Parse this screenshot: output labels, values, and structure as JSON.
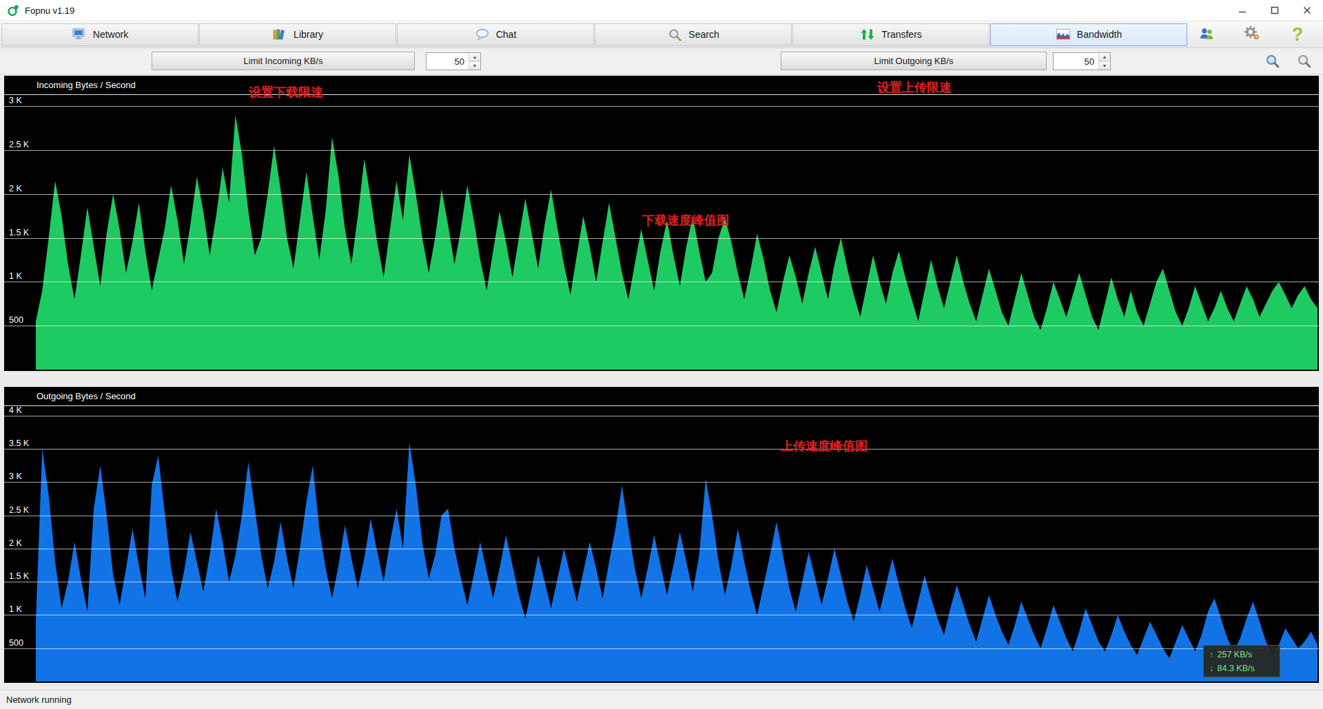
{
  "window": {
    "title": "Fopnu v1.19"
  },
  "nav_tabs": [
    {
      "label": "Network",
      "icon": "network-icon"
    },
    {
      "label": "Library",
      "icon": "library-icon"
    },
    {
      "label": "Chat",
      "icon": "chat-icon"
    },
    {
      "label": "Search",
      "icon": "search-icon"
    },
    {
      "label": "Transfers",
      "icon": "transfers-icon"
    },
    {
      "label": "Bandwidth",
      "icon": "bandwidth-icon",
      "active": true
    }
  ],
  "toolbar": {
    "limit_incoming": "Limit Incoming KB/s",
    "incoming_value": "50",
    "limit_outgoing": "Limit Outgoing KB/s",
    "outgoing_value": "50"
  },
  "icons": {
    "spin_up": "▲",
    "spin_down": "▼",
    "up_arrow": "↑",
    "down_arrow": "↓"
  },
  "annotations": {
    "set_download_limit": "设置下载限速",
    "set_upload_limit": "设置上传限速",
    "download_peak": "下载速度峰值图",
    "upload_peak": "上传速度峰值图"
  },
  "rate_overlay": {
    "up": "257 KB/s",
    "down": "84.3 KB/s"
  },
  "status": "Network running",
  "colors": {
    "incoming_fill": "#1ecb62",
    "outgoing_fill": "#1273e6",
    "chart_bg": "#000000",
    "grid": "#ffffff",
    "annotation_red": "#e02020",
    "active_tab": "#d9e8f8"
  },
  "chart_data": [
    {
      "type": "area",
      "title": "Incoming Bytes / Second",
      "color": "#1ecb62",
      "ymax": 3080,
      "yticks": [
        {
          "v": 3000,
          "label": "3 K"
        },
        {
          "v": 2500,
          "label": "2.5 K"
        },
        {
          "v": 2000,
          "label": "2 K"
        },
        {
          "v": 1500,
          "label": "1.5 K"
        },
        {
          "v": 1000,
          "label": "1 K"
        },
        {
          "v": 500,
          "label": "500"
        }
      ],
      "values": [
        550,
        900,
        1500,
        2150,
        1750,
        1200,
        800,
        1300,
        1850,
        1400,
        950,
        1550,
        2000,
        1600,
        1100,
        1450,
        1900,
        1350,
        900,
        1250,
        1600,
        2100,
        1700,
        1200,
        1650,
        2200,
        1800,
        1300,
        1750,
        2300,
        1900,
        2900,
        2450,
        1800,
        1300,
        1500,
        2000,
        2550,
        2050,
        1500,
        1150,
        1700,
        2250,
        1750,
        1250,
        1800,
        2650,
        2200,
        1600,
        1200,
        1750,
        2400,
        1950,
        1450,
        1050,
        1600,
        2150,
        1700,
        2450,
        2000,
        1500,
        1100,
        1500,
        2050,
        1650,
        1200,
        1600,
        2100,
        1700,
        1250,
        900,
        1350,
        1800,
        1450,
        1050,
        1500,
        1950,
        1550,
        1150,
        1650,
        2050,
        1600,
        1200,
        850,
        1300,
        1750,
        1400,
        1000,
        1450,
        1900,
        1500,
        1100,
        800,
        1200,
        1600,
        1250,
        900,
        1350,
        1700,
        1300,
        950,
        1400,
        1750,
        1350,
        1000,
        1100,
        1500,
        1730,
        1450,
        1100,
        800,
        1150,
        1550,
        1250,
        900,
        650,
        1000,
        1300,
        1050,
        750,
        1100,
        1400,
        1100,
        800,
        1200,
        1500,
        1150,
        850,
        600,
        950,
        1300,
        1000,
        750,
        1100,
        1350,
        1050,
        800,
        550,
        900,
        1250,
        950,
        700,
        1000,
        1300,
        1000,
        750,
        550,
        850,
        1150,
        900,
        650,
        500,
        800,
        1100,
        850,
        600,
        450,
        700,
        1000,
        800,
        600,
        850,
        1100,
        850,
        600,
        450,
        750,
        1050,
        800,
        600,
        900,
        650,
        500,
        750,
        1000,
        1150,
        900,
        650,
        500,
        700,
        950,
        750,
        550,
        700,
        900,
        700,
        550,
        750,
        950,
        800,
        600,
        750,
        900,
        1000,
        850,
        700,
        850,
        950,
        800,
        700
      ]
    },
    {
      "type": "area",
      "title": "Outgoing Bytes / Second",
      "color": "#1273e6",
      "ymax": 4080,
      "yticks": [
        {
          "v": 4000,
          "label": "4 K"
        },
        {
          "v": 3500,
          "label": "3.5 K"
        },
        {
          "v": 3000,
          "label": "3 K"
        },
        {
          "v": 2500,
          "label": "2.5 K"
        },
        {
          "v": 2000,
          "label": "2 K"
        },
        {
          "v": 1500,
          "label": "1.5 K"
        },
        {
          "v": 1000,
          "label": "1 K"
        },
        {
          "v": 500,
          "label": "500"
        }
      ],
      "values": [
        900,
        3500,
        2800,
        1800,
        1100,
        1500,
        2100,
        1550,
        1050,
        2600,
        3250,
        2500,
        1600,
        1150,
        1700,
        2300,
        1750,
        1250,
        2950,
        3400,
        2550,
        1700,
        1200,
        1650,
        2250,
        1800,
        1350,
        1900,
        2600,
        2100,
        1500,
        1900,
        2500,
        3300,
        2600,
        1900,
        1400,
        1800,
        2400,
        1850,
        1400,
        2000,
        2700,
        3250,
        2300,
        1700,
        1250,
        1750,
        2350,
        1850,
        1400,
        1850,
        2450,
        1950,
        1500,
        2100,
        2600,
        2000,
        3600,
        2950,
        2100,
        1550,
        1900,
        2500,
        2600,
        2000,
        1550,
        1150,
        1600,
        2100,
        1650,
        1250,
        1700,
        2200,
        1750,
        1300,
        950,
        1400,
        1900,
        1500,
        1100,
        1550,
        2000,
        1600,
        1200,
        1650,
        2100,
        1700,
        1250,
        1800,
        2300,
        2950,
        2300,
        1700,
        1250,
        1700,
        2200,
        1750,
        1300,
        1750,
        2250,
        1800,
        1350,
        1900,
        3050,
        2500,
        1800,
        1300,
        1750,
        2300,
        1800,
        1350,
        1000,
        1450,
        1900,
        2400,
        1900,
        1400,
        1050,
        1500,
        1950,
        1550,
        1150,
        1550,
        2000,
        1600,
        1200,
        900,
        1300,
        1750,
        1400,
        1050,
        1450,
        1850,
        1450,
        1100,
        800,
        1200,
        1600,
        1250,
        950,
        700,
        1100,
        1450,
        1150,
        850,
        600,
        950,
        1300,
        1000,
        750,
        550,
        850,
        1200,
        950,
        700,
        500,
        800,
        1150,
        900,
        650,
        450,
        750,
        1100,
        850,
        600,
        450,
        700,
        1000,
        750,
        550,
        400,
        650,
        900,
        700,
        500,
        350,
        600,
        850,
        650,
        450,
        700,
        1050,
        1250,
        950,
        650,
        450,
        650,
        950,
        1200,
        900,
        600,
        400,
        550,
        800,
        650,
        500,
        600,
        750,
        550
      ]
    }
  ]
}
